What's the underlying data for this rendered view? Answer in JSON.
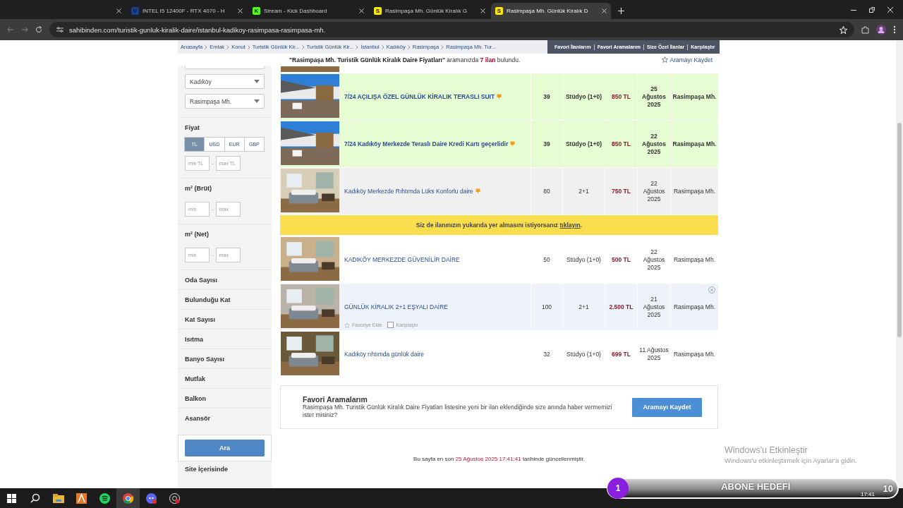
{
  "browser": {
    "tabs": [
      {
        "selected": false
      },
      {
        "title": "INTEL I5 12400F - RTX 4070 - H",
        "favicon": {
          "letter": "V",
          "color": "#1d3f8f"
        },
        "selected": false
      },
      {
        "title": "Stream - Kick Dashboard",
        "favicon": {
          "letter": "K",
          "color": "#53fc18"
        },
        "selected": false
      },
      {
        "title": "Rasimpaşa Mh. Günlük Kiralık G",
        "favicon": {
          "letter": "S",
          "color": "#ffe800"
        },
        "selected": false
      },
      {
        "title": "Rasimpaşa Mh. Günlük Kiralık D",
        "favicon": {
          "letter": "S",
          "color": "#ffe800"
        },
        "selected": true
      }
    ],
    "url": "sahibinden.com/turistik-gunluk-kiralik-daire/istanbul-kadikoy-rasimpasa-rasimpasa-mh."
  },
  "breadcrumb": [
    "Anasayfa",
    "Emlak",
    "Konut",
    "Turistik Günlük Kir...",
    "Turistik Günlük Kir...",
    "İstanbul",
    "Kadıköy",
    "Rasimpaşa",
    "Rasimpaşa Mh. Tur..."
  ],
  "user_links": [
    "Favori İlanlarım",
    "Favori Aramalarım",
    "Size Özel İlanlar",
    "Karşılaştır"
  ],
  "result": {
    "query": "\"Rasimpaşa Mh. Turistik Günlük Kiralık Daire Fiyatları\"",
    "text_middle": "aramanızda",
    "count": "7 ilan",
    "text_end": "bulundu.",
    "save_link": "Aramayı Kaydet"
  },
  "sidebar": {
    "items": [
      {
        "kind": "select",
        "value": "Kadıköy"
      },
      {
        "kind": "select",
        "value": "Rasimpaşa Mh."
      },
      {
        "kind": "section",
        "title": "Fiyat",
        "currencies": [
          {
            "label": "TL",
            "selected": true
          },
          {
            "label": "USD",
            "selected": false
          },
          {
            "label": "EUR",
            "selected": false
          },
          {
            "label": "GBP",
            "selected": false
          }
        ],
        "min_placeholder": "min TL",
        "separator": "-",
        "max_placeholder": "max TL"
      },
      {
        "kind": "section",
        "title": "m² (Brüt)",
        "min_placeholder": "min",
        "separator": "-",
        "max_placeholder": "max"
      },
      {
        "kind": "section",
        "title": "m² (Net)",
        "min_placeholder": "min",
        "separator": "-",
        "max_placeholder": "max"
      },
      {
        "kind": "section",
        "title": "Oda Sayısı"
      },
      {
        "kind": "section",
        "title": "Bulunduğu Kat"
      },
      {
        "kind": "section",
        "title": "Kat Sayısı"
      },
      {
        "kind": "section",
        "title": "Isıtma"
      },
      {
        "kind": "section",
        "title": "Banyo Sayısı"
      },
      {
        "kind": "section",
        "title": "Mutfak"
      },
      {
        "kind": "section",
        "title": "Balkon"
      },
      {
        "kind": "section",
        "title": "Asansör"
      },
      {
        "kind": "section",
        "title": "Site İçerisinde"
      }
    ],
    "search_button": "Ara"
  },
  "listings": [
    {
      "kind": "cut"
    },
    {
      "kind": "listing",
      "featured": true,
      "shaded": false,
      "title": "7/24 AÇILIŞA ÖZEL GÜNLÜK KİRALIK TERASLI SUIT",
      "doping": true,
      "m2": "39",
      "rooms": "Stüdyo (1+0)",
      "price": "850 TL",
      "date": "25 Ağustos 2025",
      "location": "Rasimpaşa Mh.",
      "hovered": false
    },
    {
      "kind": "listing",
      "featured": true,
      "shaded": false,
      "title": "7/24 Kadıköy Merkezde Teraslı Daire Kredi Kartı geçerlidir",
      "doping": true,
      "m2": "39",
      "rooms": "Stüdyo (1+0)",
      "price": "850 TL",
      "date": "22 Ağustos 2025",
      "location": "Rasimpaşa Mh.",
      "hovered": false
    },
    {
      "kind": "listing",
      "featured": false,
      "shaded": true,
      "title": "Kadıköy Merkezde Rıhtımda Lüks Konforlu daire",
      "doping": true,
      "m2": "80",
      "rooms": "2+1",
      "price": "750 TL",
      "date": "22 Ağustos 2025",
      "location": "Rasimpaşa Mh.",
      "hovered": false
    },
    {
      "kind": "banner",
      "text": "Siz de ilanınızın yukarıda yer almasını istiyorsanız",
      "link": "tıklayın",
      "end": "."
    },
    {
      "kind": "listing",
      "featured": false,
      "shaded": false,
      "title": "KADIKÖY MERKEZDE GÜVENİLİR DAİRE",
      "doping": false,
      "m2": "50",
      "rooms": "Stüdyo (1+0)",
      "price": "500 TL",
      "date": "22 Ağustos 2025",
      "location": "Rasimpaşa Mh.",
      "hovered": false
    },
    {
      "kind": "listing",
      "featured": false,
      "shaded": false,
      "title": "GÜNLÜK KİRALIK 2+1 EŞYALI DAİRE",
      "doping": false,
      "m2": "100",
      "rooms": "2+1",
      "price": "2.500 TL",
      "date": "21 Ağustos 2025",
      "location": "Rasimpaşa Mh.",
      "hovered": true,
      "favorite_label": "Favoriye Ekle",
      "compare_label": "Karşılaştır",
      "compare_checked": false
    },
    {
      "kind": "listing",
      "featured": false,
      "shaded": false,
      "title": "Kadıköy rıhtımda günlük daire",
      "doping": false,
      "m2": "32",
      "rooms": "Stüdyo (1+0)",
      "price": "699 TL",
      "date": "11 Ağustos 2025",
      "location": "Rasimpaşa Mh.",
      "hovered": false
    }
  ],
  "favorite_searches": {
    "title": "Favori Aramalarım",
    "text": "Rasimpaşa Mh. Turistik Günlük Kiralık Daire Fiyatları listesine yeni bir ilan eklendiğinde size anında haber vermemizi ister misiniz?",
    "button": "Aramayı Kaydet"
  },
  "footer": {
    "text_before": "Bu sayfa en son",
    "timestamp": "25 Ağustos 2025 17:41:41",
    "text_after": "tarihinde güncellenmiştir."
  },
  "activation": {
    "title": "Windows'u Etkinleştir",
    "text": "Windows'u etkinleştirmek için Ayarlar'a gidin."
  },
  "taskbar": {
    "time": "17:41"
  },
  "stream_goal": {
    "current": "1",
    "label": "ABONE HEDEFİ",
    "target": "10"
  }
}
